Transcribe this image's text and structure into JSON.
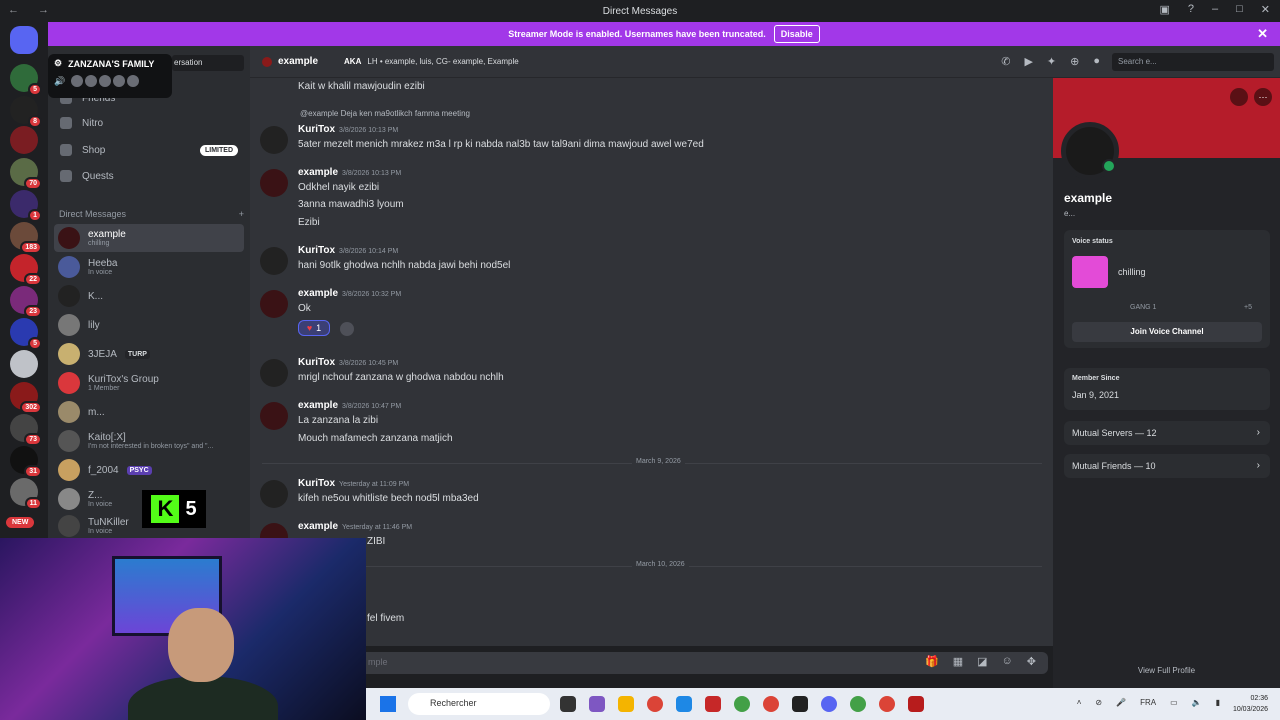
{
  "window": {
    "title": "Direct Messages"
  },
  "banner": {
    "text": "Streamer Mode is enabled. Usernames have been truncated.",
    "button": "Disable"
  },
  "guild_badges": [
    "5",
    "8",
    "70",
    "1",
    "183",
    "22",
    "23",
    "5",
    "302",
    "73",
    "31",
    "11"
  ],
  "guild_new": "NEW",
  "popup": {
    "title": "ZANZANA'S FAMILY"
  },
  "conversation_tab": "ersation",
  "nav": {
    "friends": "Friends",
    "nitro": "Nitro",
    "shop": "Shop",
    "shop_badge": "LIMITED",
    "quests": "Quests"
  },
  "dm_header": {
    "label": "Direct Messages",
    "add": "+"
  },
  "dms": [
    {
      "name": "example",
      "sub": "chilling"
    },
    {
      "name": "Heeba",
      "sub": "In voice"
    },
    {
      "name": "K...",
      "sub": ""
    },
    {
      "name": "lily",
      "sub": ""
    },
    {
      "name": "3JEJA",
      "tag": "TURP"
    },
    {
      "name": "KuriTox's Group",
      "sub": "1 Member"
    },
    {
      "name": "m...",
      "sub": ""
    },
    {
      "name": "Kaito[:X]",
      "sub": "I'm not interested in broken toys\" and \"..."
    },
    {
      "name": "f_2004",
      "tag": "PSYC"
    },
    {
      "name": "Z...",
      "sub": "In voice"
    },
    {
      "name": "TuNKiller",
      "sub": "In voice"
    }
  ],
  "chat_header": {
    "name": "example",
    "aka_label": "AKA",
    "aka": "LH • example, luis, CG- example, Example",
    "search": "Search e..."
  },
  "messages": {
    "m0_line": "Kait w khalil mawjoudin ezibi",
    "m1_reply": "@example Deja ken ma9otlikch famma meeting",
    "m1_author": "KuriTox",
    "m1_ts": "3/8/2026 10:13 PM",
    "m1_line": "5ater mezelt menich mrakez m3a l rp ki nabda nal3b taw tal9ani dima mawjoud awel we7ed",
    "m2_author": "example",
    "m2_ts": "3/8/2026 10:13 PM",
    "m2_l1": "Odkhel nayik ezibi",
    "m2_l2": "3anna mawadhi3 lyoum",
    "m2_l3": "Ezibi",
    "m3_author": "KuriTox",
    "m3_ts": "3/8/2026 10:14 PM",
    "m3_line": "hani 9otlk ghodwa nchlh nabda jawi behi nod5el",
    "m4_author": "example",
    "m4_ts": "3/8/2026 10:32 PM",
    "m4_line": "Ok",
    "m4_reaction": "1",
    "m5_author": "KuriTox",
    "m5_ts": "3/8/2026 10:45 PM",
    "m5_line": "mrigl nchouf zanzana w ghodwa nabdou nchlh",
    "m6_author": "example",
    "m6_ts": "3/8/2026 10:47 PM",
    "m6_l1": "La zanzana la zibi",
    "m6_l2": "Mouch mafamech zanzana matjich",
    "div1": "March 9, 2026",
    "m7_author": "KuriTox",
    "m7_ts": "Yesterday at 11:09 PM",
    "m7_line": "kifeh ne5ou whitliste bech nod5l mba3ed",
    "m8_author": "example",
    "m8_ts": "Yesterday at 11:46 PM",
    "m8_line": "ZIBI",
    "div2": "March 10, 2026",
    "m9_line": "fel fivem"
  },
  "composer": {
    "placeholder": "mple"
  },
  "profile": {
    "name": "example",
    "sub": "e...",
    "voice_label": "Voice status",
    "voice_status": "chilling",
    "voice_channel": "GANG 1",
    "voice_more": "+5",
    "join_button": "Join Voice Channel",
    "member_since_label": "Member Since",
    "member_since": "Jan 9, 2021",
    "mutual_servers": "Mutual Servers — 12",
    "mutual_friends": "Mutual Friends — 10",
    "view_full": "View Full Profile"
  },
  "stream_overlay": {
    "number": "5"
  },
  "taskbar": {
    "search": "Rechercher",
    "lang": "FRA",
    "time": "02:36",
    "date": "10/03/2026"
  },
  "colors": {
    "accent": "#5865f2",
    "streamer_banner": "#a238e8",
    "online": "#23a55a",
    "profile_banner": "#b51c2a"
  }
}
